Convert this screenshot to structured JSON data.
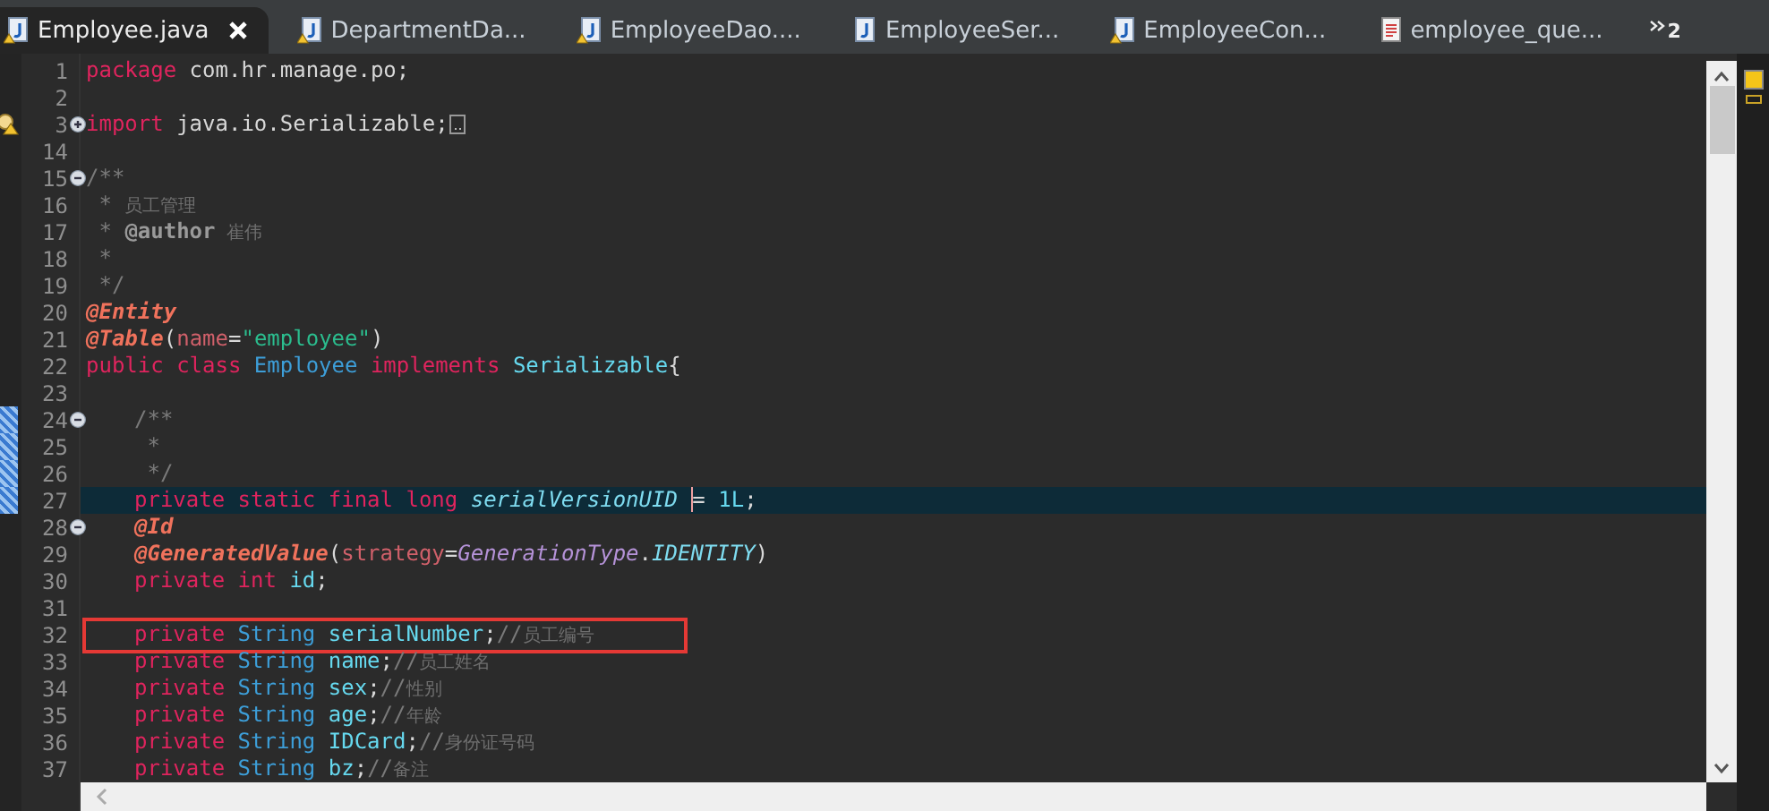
{
  "tabs": [
    {
      "label": "Employee.java",
      "kind": "java",
      "warning": true,
      "selected": true
    },
    {
      "label": "DepartmentDa...",
      "kind": "java",
      "warning": true,
      "selected": false
    },
    {
      "label": "EmployeeDao....",
      "kind": "java",
      "warning": true,
      "selected": false
    },
    {
      "label": "EmployeeSer...",
      "kind": "java",
      "warning": false,
      "selected": false
    },
    {
      "label": "EmployeeCon...",
      "kind": "java",
      "warning": true,
      "selected": false
    },
    {
      "label": "employee_que...",
      "kind": "text",
      "warning": false,
      "selected": false
    }
  ],
  "overflow_count": "2",
  "lines": [
    {
      "number": "1",
      "tokens": [
        {
          "text": "package",
          "kind": "keyword"
        },
        {
          "text": " com.hr.manage.po;",
          "kind": "plain"
        }
      ]
    },
    {
      "number": "2"
    },
    {
      "number": "3",
      "folded": true,
      "warning": true,
      "tokens": [
        {
          "text": "import",
          "kind": "keyword"
        },
        {
          "text": " java.io.Serializable;",
          "kind": "plain"
        }
      ]
    },
    {
      "number": "14"
    },
    {
      "number": "15",
      "folded": false,
      "tokens": [
        {
          "text": "/**",
          "kind": "comment"
        }
      ]
    },
    {
      "number": "16",
      "tokens": [
        {
          "text": " * ",
          "kind": "comment"
        },
        {
          "text": "员工管理",
          "kind": "cjk"
        }
      ]
    },
    {
      "number": "17",
      "tokens": [
        {
          "text": " * ",
          "kind": "comment"
        },
        {
          "text": "@author",
          "kind": "tag"
        },
        {
          "text": " 崔伟",
          "kind": "cjk"
        }
      ]
    },
    {
      "number": "18",
      "tokens": [
        {
          "text": " *",
          "kind": "comment"
        }
      ]
    },
    {
      "number": "19",
      "tokens": [
        {
          "text": " */",
          "kind": "comment"
        }
      ]
    },
    {
      "number": "20",
      "tokens": [
        {
          "text": "@Entity",
          "kind": "annotation"
        }
      ]
    },
    {
      "number": "21",
      "tokens": [
        {
          "text": "@Table",
          "kind": "annotation"
        },
        {
          "text": "(",
          "kind": "plain"
        },
        {
          "text": "name",
          "kind": "attribute"
        },
        {
          "text": "=",
          "kind": "plain"
        },
        {
          "text": "\"employee\"",
          "kind": "string"
        },
        {
          "text": ")",
          "kind": "plain"
        }
      ]
    },
    {
      "number": "22",
      "tokens": [
        {
          "text": "public class ",
          "kind": "keyword"
        },
        {
          "text": "Employee ",
          "kind": "type"
        },
        {
          "text": "implements ",
          "kind": "keyword"
        },
        {
          "text": "Serializable",
          "kind": "identifier"
        },
        {
          "text": "{",
          "kind": "plain"
        }
      ]
    },
    {
      "number": "23"
    },
    {
      "number": "24",
      "folded": false,
      "changed": true,
      "indented": true,
      "tokens": [
        {
          "text": "/**",
          "kind": "comment"
        }
      ]
    },
    {
      "number": "25",
      "changed": true,
      "indented": true,
      "tokens": [
        {
          "text": " *",
          "kind": "comment"
        }
      ]
    },
    {
      "number": "26",
      "changed": true,
      "indented": true,
      "tokens": [
        {
          "text": " */",
          "kind": "comment"
        }
      ]
    },
    {
      "number": "27",
      "changed": true,
      "indented": true,
      "current": true,
      "tokens": [
        {
          "text": "private static final long ",
          "kind": "keyword"
        },
        {
          "text": "serialVersionUID ",
          "kind": "constant"
        },
        {
          "text": "= ",
          "kind": "plain",
          "caret": true
        },
        {
          "text": "1L",
          "kind": "number"
        },
        {
          "text": ";",
          "kind": "plain"
        }
      ]
    },
    {
      "number": "28",
      "folded": false,
      "indented": true,
      "tokens": [
        {
          "text": "@Id",
          "kind": "annotation"
        }
      ]
    },
    {
      "number": "29",
      "indented": true,
      "tokens": [
        {
          "text": "@GeneratedValue",
          "kind": "annotation"
        },
        {
          "text": "(",
          "kind": "plain"
        },
        {
          "text": "strategy",
          "kind": "attribute"
        },
        {
          "text": "=",
          "kind": "plain"
        },
        {
          "text": "GenerationType",
          "kind": "enum"
        },
        {
          "text": ".",
          "kind": "plain"
        },
        {
          "text": "IDENTITY",
          "kind": "constant"
        },
        {
          "text": ")",
          "kind": "plain"
        }
      ]
    },
    {
      "number": "30",
      "indented": true,
      "tokens": [
        {
          "text": "private int ",
          "kind": "keyword"
        },
        {
          "text": "id",
          "kind": "identifier"
        },
        {
          "text": ";",
          "kind": "plain"
        }
      ]
    },
    {
      "number": "31"
    },
    {
      "number": "32",
      "indented": true,
      "boxed": true,
      "tokens": [
        {
          "text": "private ",
          "kind": "keyword"
        },
        {
          "text": "String ",
          "kind": "type"
        },
        {
          "text": "serialNumber",
          "kind": "identifier"
        },
        {
          "text": ";",
          "kind": "plain"
        },
        {
          "text": "//",
          "kind": "comment"
        },
        {
          "text": "员工编号",
          "kind": "cjk"
        }
      ]
    },
    {
      "number": "33",
      "indented": true,
      "tokens": [
        {
          "text": "private ",
          "kind": "keyword"
        },
        {
          "text": "String ",
          "kind": "type"
        },
        {
          "text": "name",
          "kind": "identifier"
        },
        {
          "text": ";",
          "kind": "plain"
        },
        {
          "text": "//",
          "kind": "comment"
        },
        {
          "text": "员工姓名",
          "kind": "cjk"
        }
      ]
    },
    {
      "number": "34",
      "indented": true,
      "tokens": [
        {
          "text": "private ",
          "kind": "keyword"
        },
        {
          "text": "String ",
          "kind": "type"
        },
        {
          "text": "sex",
          "kind": "identifier"
        },
        {
          "text": ";",
          "kind": "plain"
        },
        {
          "text": "//",
          "kind": "comment"
        },
        {
          "text": "性别",
          "kind": "cjk"
        }
      ]
    },
    {
      "number": "35",
      "indented": true,
      "tokens": [
        {
          "text": "private ",
          "kind": "keyword"
        },
        {
          "text": "String ",
          "kind": "type"
        },
        {
          "text": "age",
          "kind": "identifier"
        },
        {
          "text": ";",
          "kind": "plain"
        },
        {
          "text": "//",
          "kind": "comment"
        },
        {
          "text": "年龄",
          "kind": "cjk"
        }
      ]
    },
    {
      "number": "36",
      "indented": true,
      "tokens": [
        {
          "text": "private ",
          "kind": "keyword"
        },
        {
          "text": "String ",
          "kind": "type"
        },
        {
          "text": "IDCard",
          "kind": "identifier"
        },
        {
          "text": ";",
          "kind": "plain"
        },
        {
          "text": "//",
          "kind": "comment"
        },
        {
          "text": "身份证号码",
          "kind": "cjk"
        }
      ]
    },
    {
      "number": "37",
      "indented": true,
      "tokens": [
        {
          "text": "private ",
          "kind": "keyword"
        },
        {
          "text": "String ",
          "kind": "type"
        },
        {
          "text": "bz",
          "kind": "identifier"
        },
        {
          "text": ";",
          "kind": "plain"
        },
        {
          "text": "//",
          "kind": "comment"
        },
        {
          "text": "备注",
          "kind": "cjk"
        }
      ]
    }
  ]
}
